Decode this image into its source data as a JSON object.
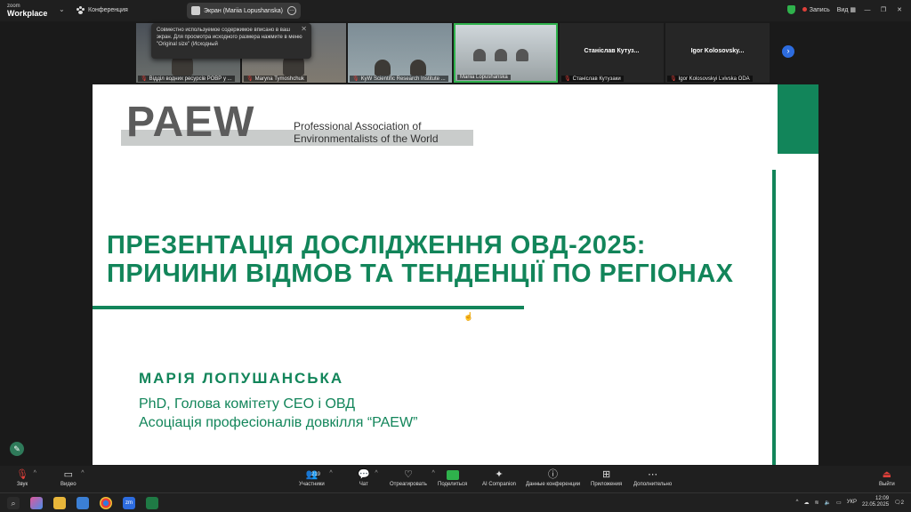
{
  "app": {
    "brand_top": "zoom",
    "brand_bottom": "Workplace",
    "meeting_title": "Конференция",
    "screen_share_label": "Экран (Mariia Lopushanska)",
    "record_label": "Запись",
    "view_label": "Вид"
  },
  "tooltip": {
    "text": "Совместно используемое содержимое вписано в ваш экран. Для просмотра исходного размера нажмите в меню \"Original size\" (Исходный"
  },
  "participants": [
    {
      "caption": "Відділ водних ресурсів РОВР у ..."
    },
    {
      "caption": "Maryna Tymoshchuk"
    },
    {
      "caption": "KyW Scientific Research Institute ..."
    },
    {
      "caption": "Mariia Lopushanska"
    },
    {
      "caption": "Станіслав Кутузаки",
      "name": "Станіслав Кутуз..."
    },
    {
      "caption": "Igor Kolosovskyi Lvivska ODA",
      "name": "Igor Kolosovsky..."
    }
  ],
  "slide": {
    "logo_text": "PAEW",
    "logo_sub_line1": "Professional Association of",
    "logo_sub_line2": "Environmentalists of the World",
    "title_line1": "ПРЕЗЕНТАЦІЯ ДОСЛІДЖЕННЯ ОВД-2025:",
    "title_line2": "ПРИЧИНИ ВІДМОВ ТА ТЕНДЕНЦІЇ ПО РЕГІОНАХ",
    "author": "МАРІЯ ЛОПУШАНСЬКА",
    "role_line1": "PhD, Голова комітету СЕО і ОВД",
    "role_line2": "Асоціація професіоналів довкілля “PAEW”"
  },
  "toolbar": {
    "audio": "Звук",
    "video": "Видео",
    "participants": "Участники",
    "participants_count": "219",
    "chat": "Чат",
    "react": "Отреагировать",
    "share": "Поделиться",
    "companion": "AI Companion",
    "conference_data": "Данные конференции",
    "apps": "Приложения",
    "more": "Дополнительно",
    "leave": "Выйти"
  },
  "taskbar": {
    "lang": "УКР",
    "time": "12:09",
    "date": "22.05.2025",
    "notif_count": "2"
  },
  "colors": {
    "accent_green": "#12855a",
    "share_green": "#2fb24c",
    "record_red": "#e0403a"
  }
}
